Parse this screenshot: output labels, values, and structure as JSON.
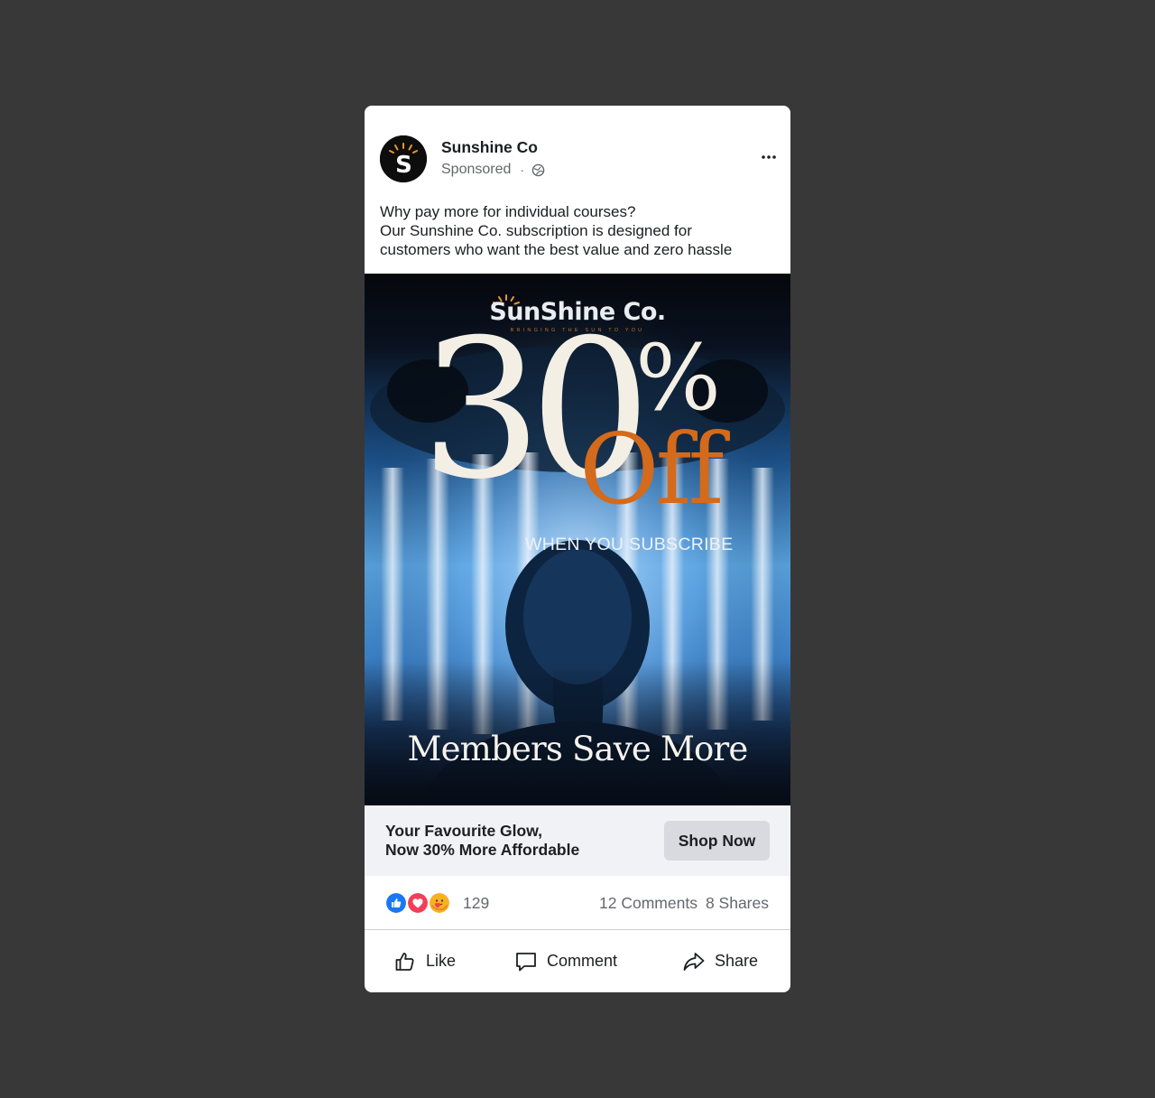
{
  "post": {
    "page_name": "Sunshine Co",
    "meta": {
      "sponsored_label": "Sponsored",
      "separator": "·",
      "privacy_icon": "globe-icon"
    },
    "more_icon": "more-options-icon",
    "caption_lines": [
      "Why pay more for individual courses?",
      "Our Sunshine Co. subscription is designed for",
      "customers who want the best value and zero hassle"
    ]
  },
  "creative": {
    "brand": "SunShine Co.",
    "tagline": "BRINGING THE SUN TO YOU",
    "discount_number": "30",
    "discount_percent": "%",
    "discount_off": "Off",
    "subheading": "WHEN YOU SUBSCRIBE",
    "footer_headline": "Members Save More"
  },
  "cta": {
    "headline_lines": [
      "Your Favourite Glow,",
      "Now 30% More Affordable"
    ],
    "button_label": "Shop Now"
  },
  "engagement": {
    "reaction_icons": [
      "like-reaction-icon",
      "love-reaction-icon",
      "care-reaction-icon"
    ],
    "reaction_count": "129",
    "comments": "12 Comments",
    "shares": "8 Shares"
  },
  "actions": {
    "like_label": "Like",
    "comment_label": "Comment",
    "share_label": "Share"
  },
  "colors": {
    "page_background": "#383838",
    "accent_orange": "#d46a1b",
    "cta_background": "#f0f2f5",
    "button_background": "#d8dadf"
  }
}
